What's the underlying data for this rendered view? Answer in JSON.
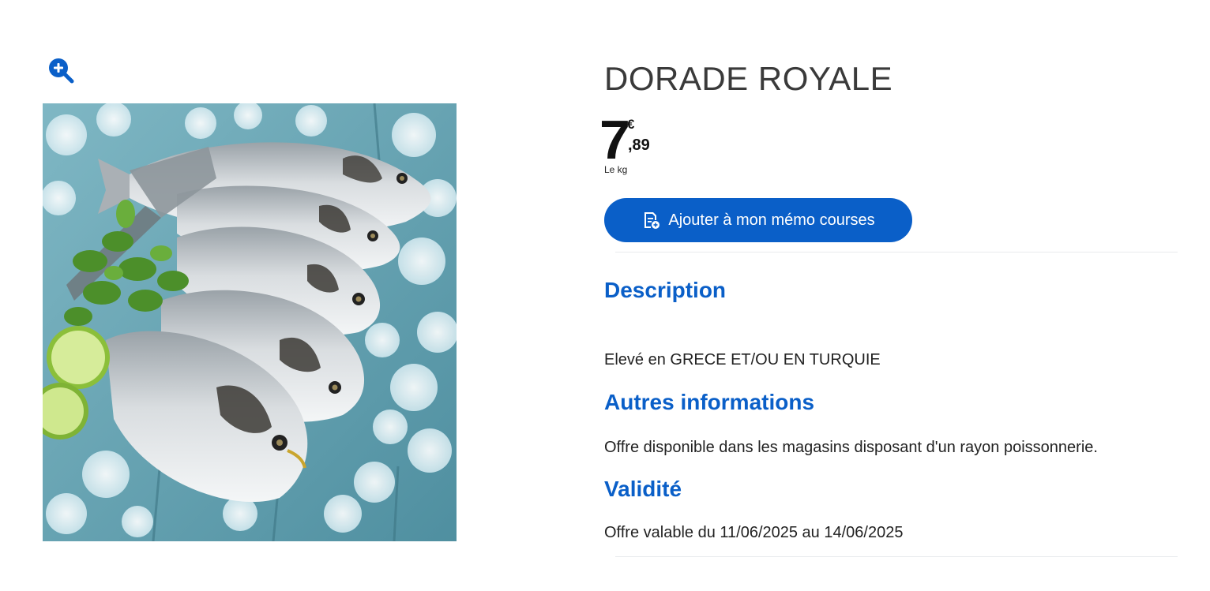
{
  "product": {
    "title": "DORADE ROYALE",
    "image_alt": "Dorades royales sur glace",
    "price": {
      "integer": "7",
      "currency": "€",
      "decimal": ",89",
      "unit": "Le kg"
    },
    "memo_button": {
      "label": "Ajouter à mon mémo courses",
      "icon": "list-add-icon"
    },
    "zoom_icon": "zoom-in-icon"
  },
  "sections": {
    "description": {
      "heading": "Description",
      "text": "Elevé en GRECE ET/OU EN TURQUIE"
    },
    "autres": {
      "heading": "Autres informations",
      "text": "Offre disponible dans les magasins disposant d'un rayon poissonnerie."
    },
    "validite": {
      "heading": "Validité",
      "text": "Offre valable du 11/06/2025 au 14/06/2025"
    }
  },
  "colors": {
    "accent": "#0a5fc8",
    "title": "#3a3a3a",
    "text": "#222222",
    "divider": "#e8eaed"
  }
}
